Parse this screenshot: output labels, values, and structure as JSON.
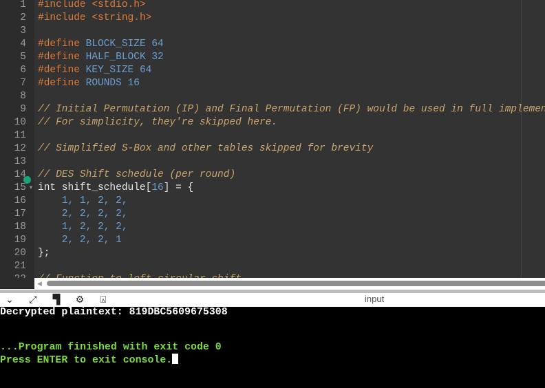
{
  "editor": {
    "line_numbers": [
      "1",
      "2",
      "3",
      "4",
      "5",
      "6",
      "7",
      "8",
      "9",
      "10",
      "11",
      "12",
      "13",
      "14",
      "15",
      "16",
      "17",
      "18",
      "19",
      "20",
      "21",
      "22"
    ],
    "lines": [
      [
        {
          "t": "#include ",
          "c": "pp"
        },
        {
          "t": "<stdio.h>",
          "c": "pp"
        }
      ],
      [
        {
          "t": "#include ",
          "c": "pp"
        },
        {
          "t": "<string.h>",
          "c": "pp"
        }
      ],
      [],
      [
        {
          "t": "#define ",
          "c": "pp"
        },
        {
          "t": "BLOCK_SIZE 64",
          "c": "nm"
        }
      ],
      [
        {
          "t": "#define ",
          "c": "pp"
        },
        {
          "t": "HALF_BLOCK 32",
          "c": "nm"
        }
      ],
      [
        {
          "t": "#define ",
          "c": "pp"
        },
        {
          "t": "KEY_SIZE 64",
          "c": "nm"
        }
      ],
      [
        {
          "t": "#define ",
          "c": "pp"
        },
        {
          "t": "ROUNDS 16",
          "c": "nm"
        }
      ],
      [],
      [
        {
          "t": "// Initial Permutation (IP) and Final Permutation (FP) would be used in full implementation",
          "c": "cm"
        }
      ],
      [
        {
          "t": "// For simplicity, they're skipped here.",
          "c": "cm"
        }
      ],
      [],
      [
        {
          "t": "// Simplified S-Box and other tables skipped for brevity",
          "c": "cm"
        }
      ],
      [],
      [
        {
          "t": "// DES Shift schedule (per round)",
          "c": "cm"
        }
      ],
      [
        {
          "t": "int shift_schedule[",
          "c": "pl"
        },
        {
          "t": "16",
          "c": "nm"
        },
        {
          "t": "] = {",
          "c": "pl"
        }
      ],
      [
        {
          "t": "    1, 1, 2, 2,",
          "c": "nm"
        }
      ],
      [
        {
          "t": "    2, 2, 2, 2,",
          "c": "nm"
        }
      ],
      [
        {
          "t": "    1, 2, 2, 2,",
          "c": "nm"
        }
      ],
      [
        {
          "t": "    2, 2, 2, 1",
          "c": "nm"
        }
      ],
      [
        {
          "t": "};",
          "c": "pl"
        }
      ],
      [],
      [
        {
          "t": "// Function to left circular shift",
          "c": "cm"
        }
      ]
    ]
  },
  "toolbar": {
    "icons": [
      "chevron-down-icon",
      "expand-icon",
      "layout-icon",
      "gear-icon",
      "debug-icon"
    ],
    "glyphs": [
      "⌄",
      "⤢",
      "▜",
      "⚙",
      "⍓"
    ],
    "input_label": "input"
  },
  "terminal": {
    "output": "Decrypted plaintext: 819DBC5609675308",
    "exit_message": "...Program finished with exit code 0",
    "prompt": "Press ENTER to exit console.",
    "output_color": "#ffffff",
    "status_color": "#7cdc3c"
  }
}
